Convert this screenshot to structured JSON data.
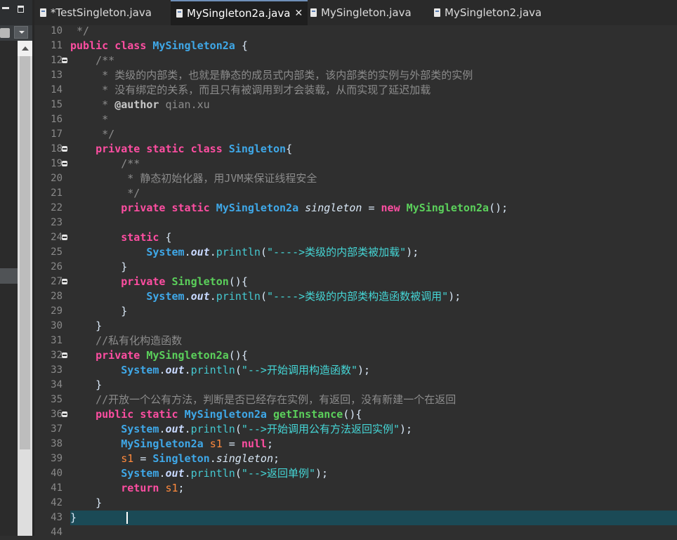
{
  "tabs": [
    {
      "label": "*TestSingleton.java",
      "active": false
    },
    {
      "label": "MySingleton2a.java",
      "active": true,
      "close": "✕"
    },
    {
      "label": "MySingleton.java",
      "active": false
    },
    {
      "label": "MySingleton2.java",
      "active": false
    }
  ],
  "lines": [
    {
      "n": "10",
      "fold": false,
      "segs": [
        [
          "cmt",
          " */"
        ]
      ]
    },
    {
      "n": "11",
      "fold": false,
      "segs": [
        [
          "kw",
          "public"
        ],
        [
          "op",
          " "
        ],
        [
          "kw",
          "class"
        ],
        [
          "op",
          " "
        ],
        [
          "cls",
          "MySingleton2a"
        ],
        [
          "op",
          " {"
        ]
      ]
    },
    {
      "n": "12",
      "fold": true,
      "segs": [
        [
          "cmt",
          "    /**"
        ]
      ]
    },
    {
      "n": "13",
      "fold": false,
      "segs": [
        [
          "cmt",
          "     * 类级的内部类，也就是静态的成员式内部类，该内部类的实例与外部类的实例"
        ]
      ]
    },
    {
      "n": "14",
      "fold": false,
      "segs": [
        [
          "cmt",
          "     * 没有绑定的关系，而且只有被调用到才会装载，从而实现了延迟加载"
        ]
      ]
    },
    {
      "n": "15",
      "fold": false,
      "segs": [
        [
          "cmt",
          "     * "
        ],
        [
          "ann",
          "@author"
        ],
        [
          "cmt",
          " qian.xu"
        ]
      ]
    },
    {
      "n": "16",
      "fold": false,
      "segs": [
        [
          "cmt",
          "     *"
        ]
      ]
    },
    {
      "n": "17",
      "fold": false,
      "segs": [
        [
          "cmt",
          "     */"
        ]
      ]
    },
    {
      "n": "18",
      "fold": true,
      "segs": [
        [
          "op",
          "    "
        ],
        [
          "kw",
          "private"
        ],
        [
          "op",
          " "
        ],
        [
          "kw",
          "static"
        ],
        [
          "op",
          " "
        ],
        [
          "kw",
          "class"
        ],
        [
          "op",
          " "
        ],
        [
          "cls",
          "Singleton"
        ],
        [
          "op",
          "{"
        ]
      ]
    },
    {
      "n": "19",
      "fold": true,
      "segs": [
        [
          "cmt",
          "        /**"
        ]
      ]
    },
    {
      "n": "20",
      "fold": false,
      "segs": [
        [
          "cmt",
          "         * 静态初始化器，用JVM来保证线程安全"
        ]
      ]
    },
    {
      "n": "21",
      "fold": false,
      "segs": [
        [
          "cmt",
          "         */"
        ]
      ]
    },
    {
      "n": "22",
      "fold": false,
      "segs": [
        [
          "op",
          "        "
        ],
        [
          "kw",
          "private"
        ],
        [
          "op",
          " "
        ],
        [
          "kw",
          "static"
        ],
        [
          "op",
          " "
        ],
        [
          "cls",
          "MySingleton2a"
        ],
        [
          "op",
          " "
        ],
        [
          "fld",
          "singleton"
        ],
        [
          "op",
          " = "
        ],
        [
          "kw",
          "new"
        ],
        [
          "op",
          " "
        ],
        [
          "ctor",
          "MySingleton2a"
        ],
        [
          "op",
          "();"
        ]
      ]
    },
    {
      "n": "23",
      "fold": false,
      "segs": [
        [
          "op",
          ""
        ]
      ]
    },
    {
      "n": "24",
      "fold": true,
      "segs": [
        [
          "op",
          "        "
        ],
        [
          "kw",
          "static"
        ],
        [
          "op",
          " {"
        ]
      ]
    },
    {
      "n": "25",
      "fold": false,
      "segs": [
        [
          "op",
          "            "
        ],
        [
          "cls",
          "System"
        ],
        [
          "op",
          "."
        ],
        [
          "sfld",
          "out"
        ],
        [
          "op",
          "."
        ],
        [
          "mth",
          "println"
        ],
        [
          "op",
          "("
        ],
        [
          "str",
          "\"---->类级的内部类被加载\""
        ],
        [
          "op",
          ");"
        ]
      ]
    },
    {
      "n": "26",
      "fold": false,
      "segs": [
        [
          "op",
          "        }"
        ]
      ]
    },
    {
      "n": "27",
      "fold": true,
      "segs": [
        [
          "op",
          "        "
        ],
        [
          "kw",
          "private"
        ],
        [
          "op",
          " "
        ],
        [
          "ctor",
          "Singleton"
        ],
        [
          "op",
          "(){"
        ]
      ]
    },
    {
      "n": "28",
      "fold": false,
      "segs": [
        [
          "op",
          "            "
        ],
        [
          "cls",
          "System"
        ],
        [
          "op",
          "."
        ],
        [
          "sfld",
          "out"
        ],
        [
          "op",
          "."
        ],
        [
          "mth",
          "println"
        ],
        [
          "op",
          "("
        ],
        [
          "str",
          "\"---->类级的内部类构造函数被调用\""
        ],
        [
          "op",
          ");"
        ]
      ]
    },
    {
      "n": "29",
      "fold": false,
      "segs": [
        [
          "op",
          "        }"
        ]
      ]
    },
    {
      "n": "30",
      "fold": false,
      "segs": [
        [
          "op",
          "    }"
        ]
      ]
    },
    {
      "n": "31",
      "fold": false,
      "segs": [
        [
          "cmt",
          "    //私有化构造函数"
        ]
      ]
    },
    {
      "n": "32",
      "fold": true,
      "segs": [
        [
          "op",
          "    "
        ],
        [
          "kw",
          "private"
        ],
        [
          "op",
          " "
        ],
        [
          "ctor",
          "MySingleton2a"
        ],
        [
          "op",
          "(){"
        ]
      ]
    },
    {
      "n": "33",
      "fold": false,
      "segs": [
        [
          "op",
          "        "
        ],
        [
          "cls",
          "System"
        ],
        [
          "op",
          "."
        ],
        [
          "sfld",
          "out"
        ],
        [
          "op",
          "."
        ],
        [
          "mth",
          "println"
        ],
        [
          "op",
          "("
        ],
        [
          "str",
          "\"-->开始调用构造函数\""
        ],
        [
          "op",
          ");"
        ]
      ]
    },
    {
      "n": "34",
      "fold": false,
      "segs": [
        [
          "op",
          "    }"
        ]
      ]
    },
    {
      "n": "35",
      "fold": false,
      "segs": [
        [
          "cmt",
          "    //开放一个公有方法，判断是否已经存在实例，有返回，没有新建一个在返回"
        ]
      ]
    },
    {
      "n": "36",
      "fold": true,
      "segs": [
        [
          "op",
          "    "
        ],
        [
          "kw",
          "public"
        ],
        [
          "op",
          " "
        ],
        [
          "kw",
          "static"
        ],
        [
          "op",
          " "
        ],
        [
          "cls",
          "MySingleton2a"
        ],
        [
          "op",
          " "
        ],
        [
          "ctor",
          "getInstance"
        ],
        [
          "op",
          "(){"
        ]
      ]
    },
    {
      "n": "37",
      "fold": false,
      "segs": [
        [
          "op",
          "        "
        ],
        [
          "cls",
          "System"
        ],
        [
          "op",
          "."
        ],
        [
          "sfld",
          "out"
        ],
        [
          "op",
          "."
        ],
        [
          "mth",
          "println"
        ],
        [
          "op",
          "("
        ],
        [
          "str",
          "\"-->开始调用公有方法返回实例\""
        ],
        [
          "op",
          ");"
        ]
      ]
    },
    {
      "n": "38",
      "fold": false,
      "segs": [
        [
          "op",
          "        "
        ],
        [
          "cls",
          "MySingleton2a"
        ],
        [
          "op",
          " "
        ],
        [
          "var",
          "s1"
        ],
        [
          "op",
          " = "
        ],
        [
          "kw",
          "null"
        ],
        [
          "op",
          ";"
        ]
      ]
    },
    {
      "n": "39",
      "fold": false,
      "segs": [
        [
          "op",
          "        "
        ],
        [
          "var",
          "s1"
        ],
        [
          "op",
          " = "
        ],
        [
          "cls",
          "Singleton"
        ],
        [
          "op",
          "."
        ],
        [
          "fld",
          "singleton"
        ],
        [
          "op",
          ";"
        ]
      ]
    },
    {
      "n": "40",
      "fold": false,
      "segs": [
        [
          "op",
          "        "
        ],
        [
          "cls",
          "System"
        ],
        [
          "op",
          "."
        ],
        [
          "sfld",
          "out"
        ],
        [
          "op",
          "."
        ],
        [
          "mth",
          "println"
        ],
        [
          "op",
          "("
        ],
        [
          "str",
          "\"-->返回单例\""
        ],
        [
          "op",
          ");"
        ]
      ]
    },
    {
      "n": "41",
      "fold": false,
      "segs": [
        [
          "op",
          "        "
        ],
        [
          "kw",
          "return"
        ],
        [
          "op",
          " "
        ],
        [
          "var",
          "s1"
        ],
        [
          "op",
          ";"
        ]
      ]
    },
    {
      "n": "42",
      "fold": false,
      "segs": [
        [
          "op",
          "    }"
        ]
      ]
    },
    {
      "n": "43",
      "fold": false,
      "current": true,
      "segs": [
        [
          "op",
          "}"
        ]
      ]
    },
    {
      "n": "44",
      "fold": false,
      "segs": [
        [
          "op",
          ""
        ]
      ]
    }
  ]
}
